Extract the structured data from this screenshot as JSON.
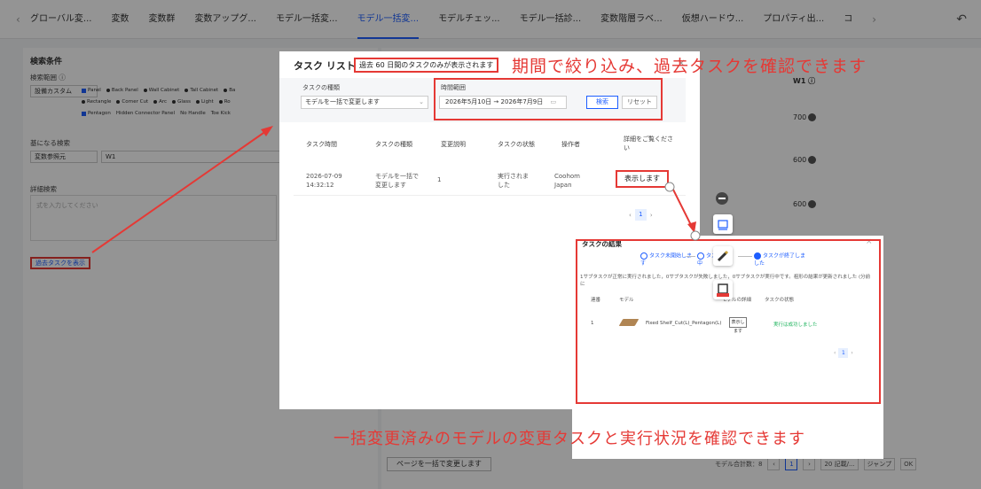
{
  "top_nav": {
    "tabs": [
      "グローバル変...",
      "変数",
      "変数群",
      "変数アップグ...",
      "モデル一括変...",
      "モデル一括変...",
      "モデルチェッ...",
      "モデル一括診...",
      "変数階層ラベ...",
      "仮想ハードウ...",
      "プロパティ出...",
      "コ"
    ],
    "active_index": 5
  },
  "left_panel": {
    "title": "検索条件",
    "range_label": "検索範囲 ⓘ",
    "range_select": "設備カスタム",
    "chips_row1": [
      "Panel",
      "Back Panel",
      "Wall Cabinet",
      "Tall Cabinet",
      "Ba"
    ],
    "chips_row2": [
      "Rectangle",
      "Corner Cut",
      "Arc",
      "Glass",
      "Light",
      "Ro"
    ],
    "chips_row3": [
      "Pentagon",
      "Hidden Connector Panel",
      "No Handle",
      "Toe Kick"
    ],
    "basis_label": "基になる検索",
    "basis_select": "変数参照元",
    "basis_value": "W1",
    "detail_label": "詳細検索",
    "detail_placeholder": "式を入力してください",
    "past_task_button": "過去タスクを表示"
  },
  "right_panel": {
    "w1_header": "W1 ⓘ",
    "prices": [
      "700",
      "600",
      "600"
    ],
    "bulk_button": "ページを一括で変更します",
    "pager_text": "モデル合計数：8",
    "pager_current": "1",
    "pager_size": "20 記載/...",
    "jump": "ジャンプ",
    "ok": "OK"
  },
  "task_modal": {
    "title": "タスク リスト",
    "note": "過去 60 日間のタスクのみが表示されます",
    "close": "×",
    "task_type_label": "タスクの種類",
    "task_type_value": "モデルを一括で変更します",
    "period_label": "時間範囲",
    "date_start": "2026年5月10日",
    "date_sep": "→",
    "date_end": "2026年7月9日",
    "search_button": "検索",
    "reset_button": "リセット",
    "columns": [
      "タスク時間",
      "タスクの種類",
      "変更説明",
      "タスクの状態",
      "操作者",
      "詳細をご覧ください"
    ],
    "row": {
      "time": "2026-07-09 14:32:12",
      "type": "モデルを一括で変更します",
      "desc": "1",
      "state": "実行されました",
      "operator": "Coohom Japan",
      "detail_button": "表示します"
    },
    "page": "1"
  },
  "result_modal": {
    "title": "タスクの結果",
    "steps": [
      "タスク未開始します",
      "タスク実行中",
      "タスクが終了しました"
    ],
    "message": "1サブタスクが正常に実行されました，0サブタスクが失敗しました，0サブタスクが実行中です。祖形の結果が更新されました (分前に",
    "columns": [
      "連番",
      "モデル",
      "モデルの詳細",
      "タスクの状態"
    ],
    "row": {
      "index": "1",
      "model": "Fixed Shelf_Cut(L)_Pentagon(L)",
      "detail": "表示します",
      "status": "実行は成功しました"
    },
    "page": "1"
  },
  "annotations": {
    "top": "期間で絞り込み、過去タスクを確認できます",
    "bottom": "一括変更済みのモデルの変更タスクと実行状況を確認できます"
  },
  "colors": {
    "accent": "#1e5eff",
    "highlight_red": "#e53935",
    "success": "#1db35c"
  }
}
